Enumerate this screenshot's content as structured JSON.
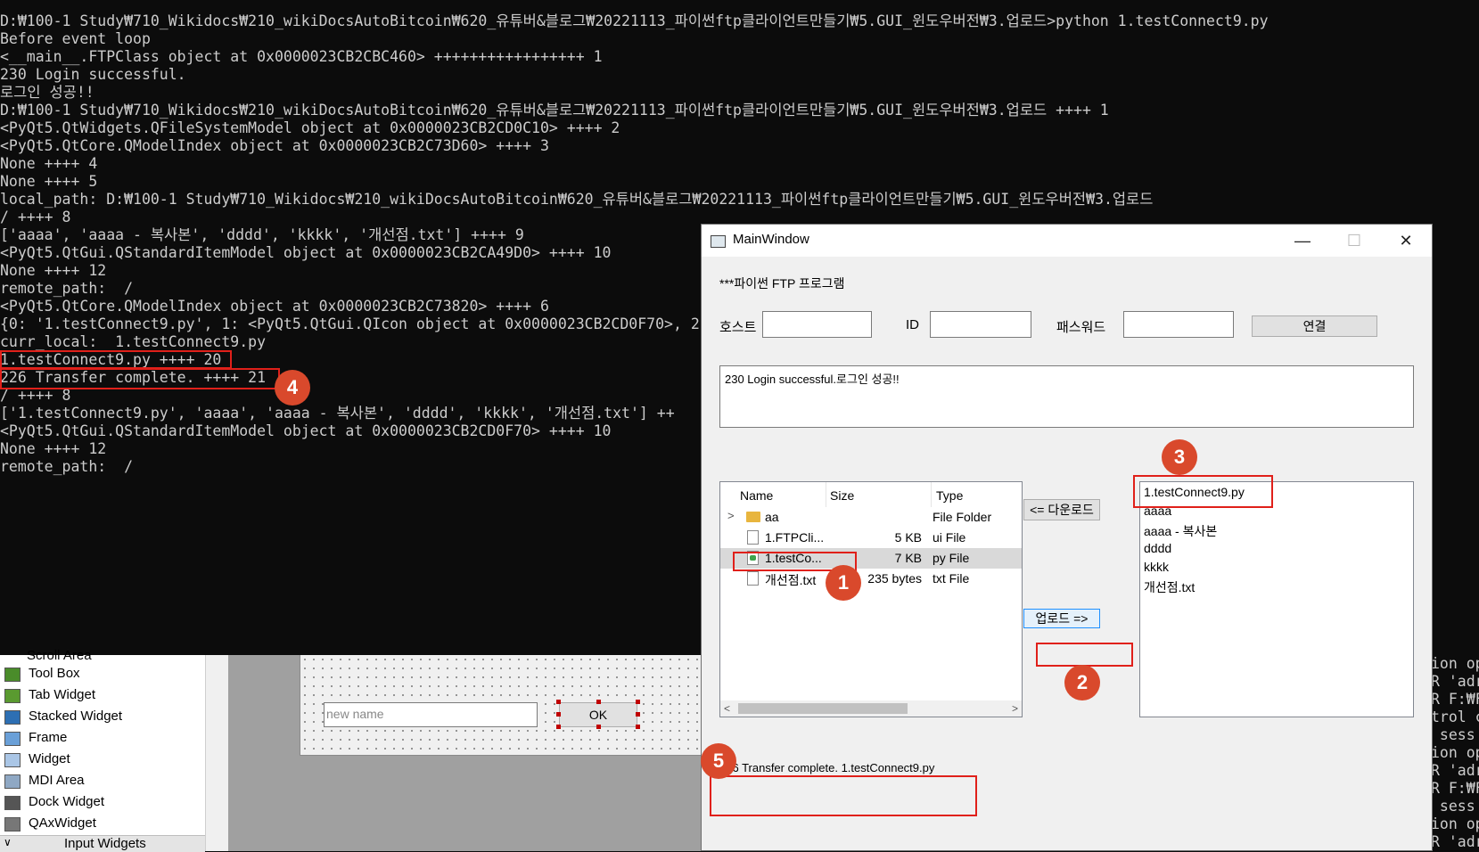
{
  "console": {
    "lines": [
      "D:₩100-1 Study₩710_Wikidocs₩210_wikiDocsAutoBitcoin₩620_유튜버&블로그₩20221113_파이썬ftp클라이언트만들기₩5.GUI_윈도우버전₩3.업로드>python 1.testConnect9.py",
      "Before event loop",
      "<__main__.FTPClass object at 0x0000023CB2CBC460> +++++++++++++++++ 1",
      "230 Login successful.",
      "로그인 성공!!",
      "D:₩100-1 Study₩710_Wikidocs₩210_wikiDocsAutoBitcoin₩620_유튜버&블로그₩20221113_파이썬ftp클라이언트만들기₩5.GUI_윈도우버전₩3.업로드 ++++ 1",
      "<PyQt5.QtWidgets.QFileSystemModel object at 0x0000023CB2CD0C10> ++++ 2",
      "<PyQt5.QtCore.QModelIndex object at 0x0000023CB2C73D60> ++++ 3",
      "None ++++ 4",
      "None ++++ 5",
      "local_path: D:₩100-1 Study₩710_Wikidocs₩210_wikiDocsAutoBitcoin₩620_유튜버&블로그₩20221113_파이썬ftp클라이언트만들기₩5.GUI_윈도우버전₩3.업로드",
      "/ ++++ 8",
      "['aaaa', 'aaaa - 복사본', 'dddd', 'kkkk', '개선점.txt'] ++++ 9",
      "<PyQt5.QtGui.QStandardItemModel object at 0x0000023CB2CA49D0> ++++ 10",
      "None ++++ 12",
      "remote_path:  /",
      "<PyQt5.QtCore.QModelIndex object at 0x0000023CB2C73820> ++++ 6",
      "{0: '1.testConnect9.py', 1: <PyQt5.QtGui.QIcon object at 0x0000023CB2CD0F70>, 2",
      "curr_local:  1.testConnect9.py",
      "1.testConnect9.py ++++ 20",
      "226 Transfer complete. ++++ 21",
      "/ ++++ 8",
      "['1.testConnect9.py', 'aaaa', 'aaaa - 복사본', 'dddd', 'kkkk', '개선점.txt'] ++",
      "<PyQt5.QtGui.QStandardItemModel object at 0x0000023CB2CD0F70> ++++ 10",
      "None ++++ 12",
      "remote_path:  /"
    ],
    "right_fragment": [
      "ion op",
      "R 'adr",
      "R F:₩F",
      "trol c",
      " sess",
      "ion op",
      "R 'adr",
      "R F:₩F",
      " sess",
      "ion op",
      "R 'adr"
    ]
  },
  "designer": {
    "scroll_area_partial": "Scroll Area",
    "widget_box": [
      {
        "label": "Tool Box",
        "icon": "tool-box-icon",
        "color": "#4a8c2a"
      },
      {
        "label": "Tab Widget",
        "icon": "tab-widget-icon",
        "color": "#5a9a30"
      },
      {
        "label": "Stacked Widget",
        "icon": "stacked-widget-icon",
        "color": "#2d6fb3"
      },
      {
        "label": "Frame",
        "icon": "frame-icon",
        "color": "#6aa0d8"
      },
      {
        "label": "Widget",
        "icon": "widget-icon",
        "color": "#aac6e6"
      },
      {
        "label": "MDI Area",
        "icon": "mdi-area-icon",
        "color": "#8fa8c4"
      },
      {
        "label": "Dock Widget",
        "icon": "dock-widget-icon",
        "color": "#555555"
      },
      {
        "label": "QAxWidget",
        "icon": "qaxwidget-icon",
        "color": "#777777"
      }
    ],
    "category": "Input Widgets",
    "form_input_placeholder": "new name",
    "form_ok": "OK"
  },
  "main_window": {
    "title": "MainWindow",
    "min_glyph": "—",
    "max_glyph": "☐",
    "close_glyph": "✕",
    "program_label": "***파이썬 FTP 프로그램",
    "host_label": "호스트",
    "id_label": "ID",
    "password_label": "패스워드",
    "host_value": "",
    "id_value": "",
    "password_value": "",
    "connect_button": "연결",
    "log_text": "230 Login successful.로그인 성공!!",
    "local_tree": {
      "headers": [
        "Name",
        "Size",
        "Type"
      ],
      "rows": [
        {
          "name": "aa",
          "size": "",
          "type": "File Folder",
          "kind": "folder"
        },
        {
          "name": "1.FTPCli...",
          "size": "5 KB",
          "type": "ui File",
          "kind": "file"
        },
        {
          "name": "1.testCo...",
          "size": "7 KB",
          "type": "py File",
          "kind": "py"
        },
        {
          "name": "개선점.txt",
          "size": "235 bytes",
          "type": "txt File",
          "kind": "file"
        }
      ]
    },
    "download_button": "<= 다운로드",
    "upload_button": "업로드 =>",
    "remote_list": [
      "1.testConnect9.py",
      "aaaa",
      "aaaa - 복사본",
      "dddd",
      "kkkk",
      "개선점.txt"
    ],
    "status_text": "226 Transfer complete. 1.testConnect9.py"
  },
  "annotations": {
    "badges": [
      "1",
      "2",
      "3",
      "4",
      "5"
    ],
    "color": "#e0201a"
  }
}
